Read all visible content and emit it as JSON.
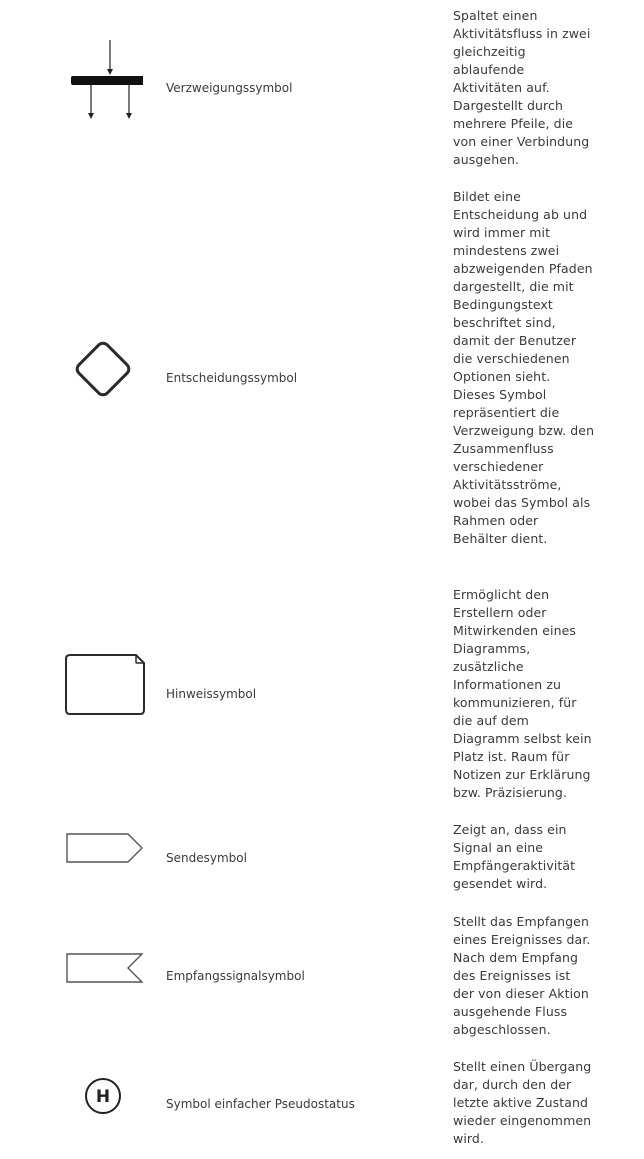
{
  "rows": [
    {
      "name": "Verzweigungssymbol",
      "icon": "fork-bar-icon",
      "description": "Spaltet einen Aktivitätsfluss in zwei gleichzeitig ablaufende Aktivitäten auf. Dargestellt durch mehrere Pfeile, die von einer Verbindung ausgehen."
    },
    {
      "name": "Entscheidungssymbol",
      "icon": "decision-diamond-icon",
      "description": "Bildet eine Entscheidung ab und wird immer mit mindestens zwei abzweigenden Pfaden dargestellt, die mit Bedingungstext beschriftet sind, damit der Benutzer die verschiedenen Optionen sieht. Dieses Symbol repräsentiert die Verzweigung bzw. den Zusammenfluss verschiedener Aktivitätsströme, wobei das Symbol als Rahmen oder Behälter dient."
    },
    {
      "name": "Hinweissymbol",
      "icon": "note-icon",
      "description": "Ermöglicht den Erstellern oder Mitwirkenden eines Diagramms, zusätzliche Informationen zu kommunizieren, für die auf dem Diagramm selbst kein Platz ist. Raum für Notizen zur Erklärung bzw. Präzisierung."
    },
    {
      "name": "Sendesymbol",
      "icon": "send-signal-icon",
      "description": "Zeigt an, dass ein Signal an eine Empfängeraktivität gesendet wird."
    },
    {
      "name": "Empfangssignalsymbol",
      "icon": "receive-signal-icon",
      "description": "Stellt das Empfangen eines Ereignisses dar. Nach dem Empfang des Ereignisses ist der von dieser Aktion ausgehende Fluss abgeschlossen."
    },
    {
      "name": "Symbol einfacher Pseudostatus",
      "icon": "shallow-history-icon",
      "icon_letter": "H",
      "description": "Stellt einen Übergang dar, durch den der letzte aktive Zustand wieder eingenommen wird."
    }
  ]
}
